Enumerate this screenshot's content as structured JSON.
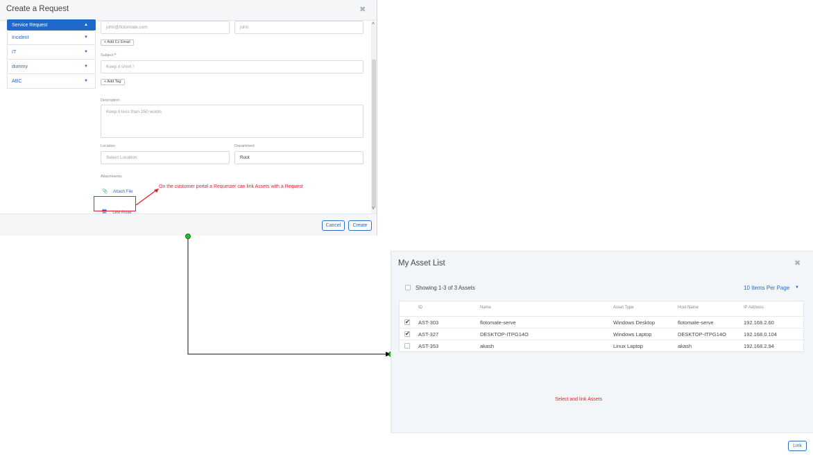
{
  "request_dialog": {
    "title": "Create a Request",
    "close_glyph": "✖",
    "sidebar": {
      "items": [
        {
          "label": "Service Request",
          "caret": "▲"
        },
        {
          "label": "Incident",
          "caret": "▼"
        },
        {
          "label": "IT",
          "caret": "▼"
        },
        {
          "label": "dummy",
          "caret": "▼"
        },
        {
          "label": "ABC",
          "caret": "▼"
        }
      ]
    },
    "form": {
      "email_value": "john@flotomate.com",
      "name_value": "john",
      "add_cc_label": "+ Add Cc Email",
      "subject_label": "Subject",
      "subject_required": "*",
      "subject_placeholder": "Keep it short !",
      "add_tag_label": "+ Add Tag",
      "description_label": "Description",
      "description_placeholder": "Keep it less than 250 words",
      "location_label": "Location",
      "location_placeholder": "Select Location",
      "department_label": "Department",
      "department_value": "Root",
      "attachments_label": "Attachments",
      "attach_file_label": "Attach File",
      "link_asset_label": "Link Asset"
    },
    "footer": {
      "cancel_label": "Cancel",
      "create_label": "Create"
    },
    "annotation": "On the customer portal a Requester can link Assets with a Request"
  },
  "asset_dialog": {
    "title": "My Asset List",
    "close_glyph": "✖",
    "showing_text": "Showing 1-3 of 3 Assets",
    "per_page_label": "10 Items Per Page",
    "columns": [
      "ID",
      "Name",
      "Asset Type",
      "Host Name",
      "IP Address"
    ],
    "rows": [
      {
        "checked": true,
        "id": "AST-303",
        "name": "flotomate-serve",
        "type": "Windows Desktop",
        "host": "flotomate-serve",
        "ip": "192.168.2.60"
      },
      {
        "checked": true,
        "id": "AST-327",
        "name": "DESKTOP-ITPG14O",
        "type": "Windows Laptop",
        "host": "DESKTOP-ITPG14O",
        "ip": "192.168.0.104"
      },
      {
        "checked": false,
        "id": "AST-353",
        "name": "akash",
        "type": "Linux Laptop",
        "host": "akash",
        "ip": "192.168.2.94"
      }
    ],
    "annotation": "Select and link Assets",
    "link_button_label": "Link"
  },
  "colors": {
    "accent": "#2a6bc2",
    "annotation": "#e01e2b",
    "connector_dot": "#22c11f"
  }
}
